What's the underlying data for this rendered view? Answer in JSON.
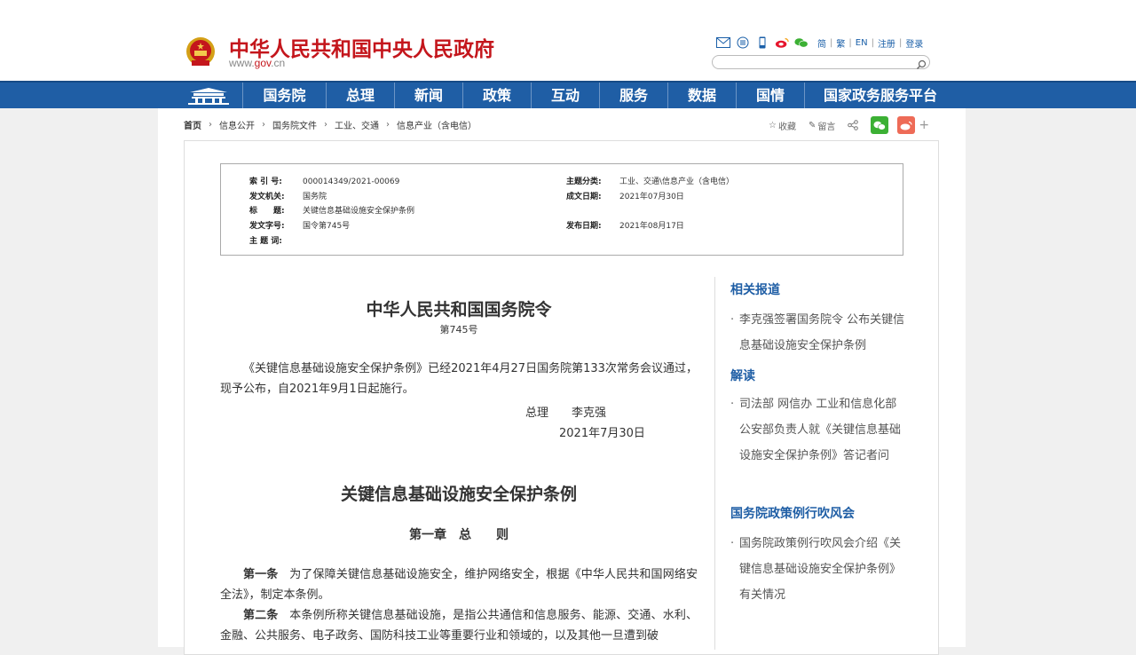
{
  "header": {
    "site_title": "中华人民共和国中央人民政府",
    "site_url_prefix": "www.",
    "site_url_highlight": "gov",
    "site_url_suffix": ".cn",
    "icons": [
      "mail-icon",
      "rss-icon",
      "mobile-icon",
      "weibo-icon",
      "wechat-icon"
    ],
    "lang_links": [
      "简",
      "繁",
      "EN",
      "注册",
      "登录"
    ],
    "search_placeholder": ""
  },
  "nav": {
    "items": [
      "国务院",
      "总理",
      "新闻",
      "政策",
      "互动",
      "服务",
      "数据",
      "国情",
      "国家政务服务平台"
    ]
  },
  "breadcrumb": {
    "home": "首页",
    "items": [
      "信息公开",
      "国务院文件",
      "工业、交通",
      "信息产业（含电信）"
    ]
  },
  "tools": {
    "favorite": "收藏",
    "comment": "留言"
  },
  "meta": {
    "index_no_label": "索 引 号:",
    "index_no": "000014349/2021-00069",
    "topic_label": "主题分类:",
    "topic": "工业、交通\\信息产业（含电信）",
    "issuer_label": "发文机关:",
    "issuer": "国务院",
    "date_label": "成文日期:",
    "date": "2021年07月30日",
    "title_label": "标　　题:",
    "title": "关键信息基础设施安全保护条例",
    "doc_no_label": "发文字号:",
    "doc_no": "国令第745号",
    "pub_label": "发布日期:",
    "pub_date": "2021年08月17日",
    "keywords_label": "主 题 词:",
    "keywords": ""
  },
  "article": {
    "title": "中华人民共和国国务院令",
    "number": "第745号",
    "intro": "《关键信息基础设施安全保护条例》已经2021年4月27日国务院第133次常务会议通过，现予公布，自2021年9月1日起施行。",
    "signer": "总理　　李克强",
    "sign_date": "2021年7月30日",
    "reg_title": "关键信息基础设施安全保护条例",
    "chapter": "第一章　总　　则",
    "art1_label": "第一条",
    "art1": "为了保障关键信息基础设施安全，维护网络安全，根据《中华人民共和国网络安全法》，制定本条例。",
    "art2_label": "第二条",
    "art2": "本条例所称关键信息基础设施，是指公共通信和信息服务、能源、交通、水利、金融、公共服务、电子政务、国防科技工业等重要行业和领域的，以及其他一旦遭到破"
  },
  "sidebar": {
    "sections": [
      {
        "title": "相关报道",
        "items": [
          "李克强签署国务院令 公布关键信息基础设施安全保护条例"
        ]
      },
      {
        "title": "解读",
        "items": [
          "司法部 网信办 工业和信息化部 公安部负责人就《关键信息基础设施安全保护条例》答记者问"
        ]
      },
      {
        "title": "国务院政策例行吹风会",
        "items": [
          "国务院政策例行吹风会介绍《关键信息基础设施安全保护条例》有关情况"
        ]
      }
    ]
  },
  "colors": {
    "brand_red": "#c4161c",
    "nav_blue": "#1f5ea5",
    "link_blue": "#1f5ea5"
  }
}
